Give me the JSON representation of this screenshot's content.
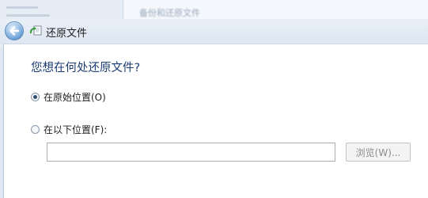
{
  "titlebar": {
    "title": "还原文件",
    "back_icon": "back-arrow-icon",
    "app_icon": "restore-files-icon"
  },
  "background": {
    "blurred_title": "备份和还原文件"
  },
  "dialog": {
    "question": "您想在何处还原文件?",
    "options": [
      {
        "label": "在原始位置(O)",
        "checked": true
      },
      {
        "label": "在以下位置(F):",
        "checked": false
      }
    ],
    "path_value": "",
    "browse_label": "浏览(W)..."
  },
  "colors": {
    "heading": "#1d3c73",
    "disabled_text": "#8c8c8c"
  }
}
